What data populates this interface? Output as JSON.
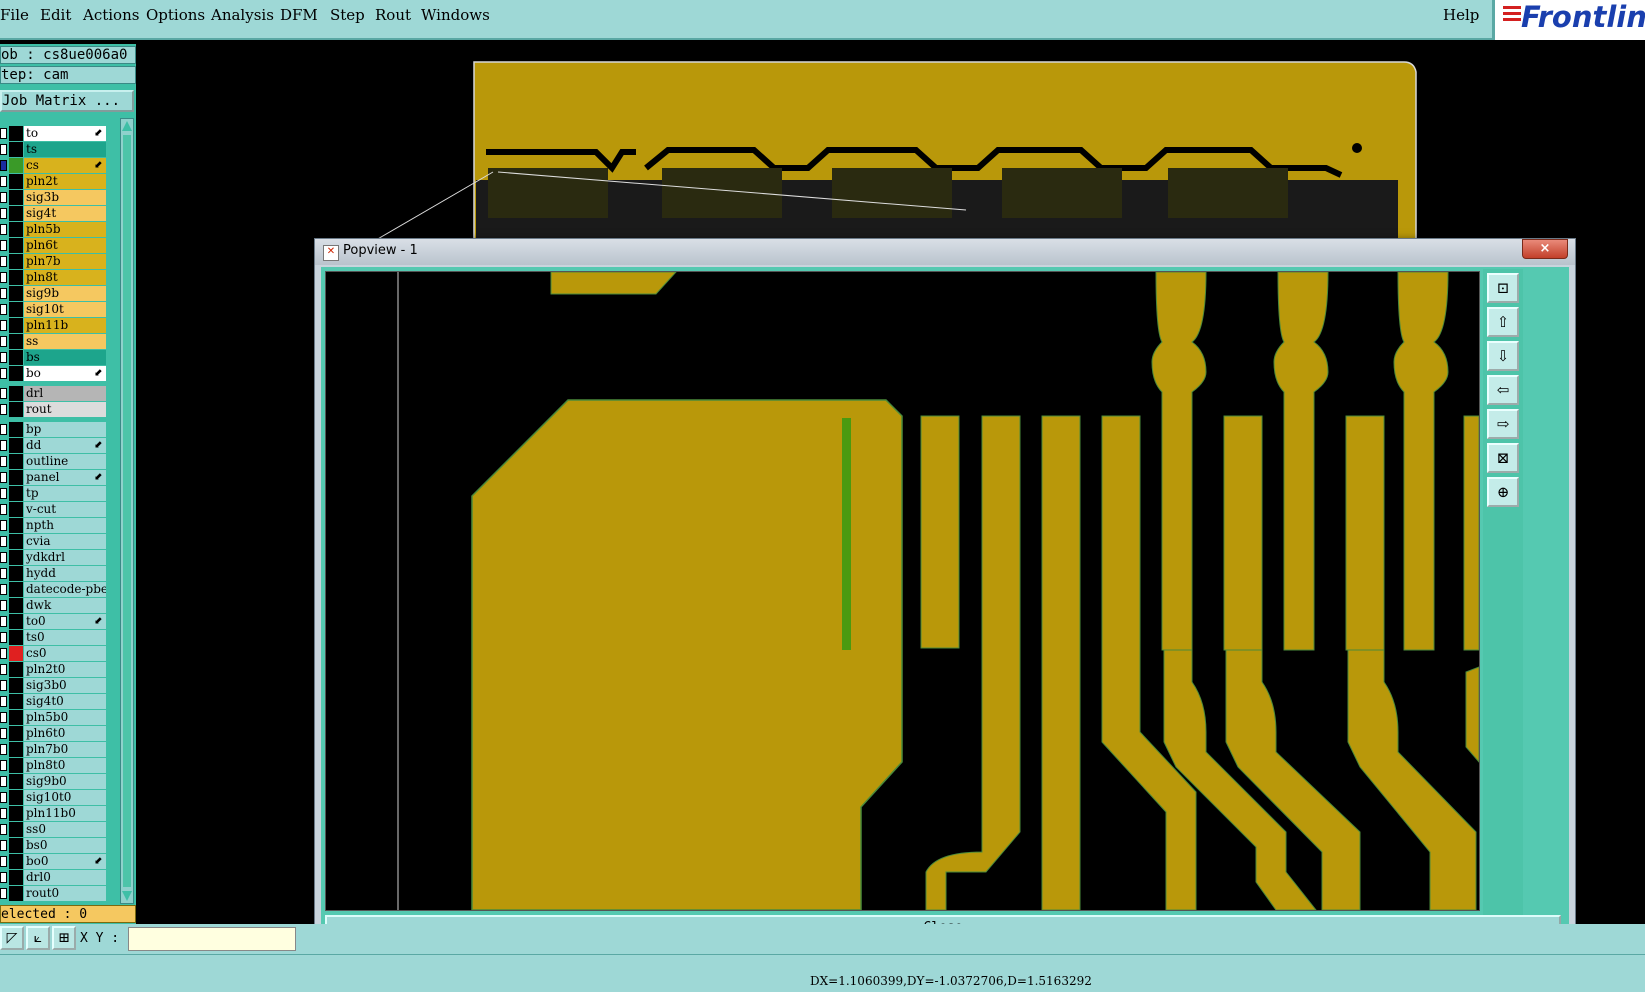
{
  "menubar": {
    "items": [
      "File",
      "Edit",
      "Actions",
      "Options",
      "Analysis",
      "DFM",
      "Step",
      "Rout",
      "Windows"
    ],
    "help": "Help",
    "logo": "Frontline"
  },
  "job": {
    "job_line": "ob  : cs8ue006a0",
    "step_line": "tep: cam",
    "matrix_button": "Job Matrix ..."
  },
  "layers": [
    {
      "name": "to",
      "bg": "#ffffff",
      "swatch": "#000000",
      "icon": true
    },
    {
      "name": "ts",
      "bg": "#1da58c",
      "swatch": "#000000"
    },
    {
      "name": "cs",
      "bg": "#d8b21d",
      "swatch": "#3a9a28",
      "icon": true,
      "checked_color": "#1a2aa0"
    },
    {
      "name": "pln2t",
      "bg": "#d8b21d",
      "swatch": "#000000"
    },
    {
      "name": "sig3b",
      "bg": "#f5c860",
      "swatch": "#000000"
    },
    {
      "name": "sig4t",
      "bg": "#f5c860",
      "swatch": "#000000"
    },
    {
      "name": "pln5b",
      "bg": "#d8b21d",
      "swatch": "#000000"
    },
    {
      "name": "pln6t",
      "bg": "#d8b21d",
      "swatch": "#000000"
    },
    {
      "name": "pln7b",
      "bg": "#d8b21d",
      "swatch": "#000000"
    },
    {
      "name": "pln8t",
      "bg": "#d8b21d",
      "swatch": "#000000"
    },
    {
      "name": "sig9b",
      "bg": "#f5c860",
      "swatch": "#000000"
    },
    {
      "name": "sig10t",
      "bg": "#f5c860",
      "swatch": "#000000"
    },
    {
      "name": "pln11b",
      "bg": "#d8b21d",
      "swatch": "#000000"
    },
    {
      "name": "ss",
      "bg": "#f5c860",
      "swatch": "#000000"
    },
    {
      "name": "bs",
      "bg": "#1da58c",
      "swatch": "#000000"
    },
    {
      "name": "bo",
      "bg": "#ffffff",
      "swatch": "#000000",
      "icon": true
    },
    {
      "name": "drl",
      "bg": "#b5b5b5",
      "swatch": "#000000",
      "gap": true
    },
    {
      "name": "rout",
      "bg": "#dcdcdc",
      "swatch": "#000000"
    },
    {
      "name": "bp",
      "bg": "#9ed8d6",
      "swatch": "#000000",
      "gap": true
    },
    {
      "name": "dd",
      "bg": "#9ed8d6",
      "swatch": "#000000",
      "icon": true
    },
    {
      "name": "outline",
      "bg": "#9ed8d6",
      "swatch": "#000000"
    },
    {
      "name": "panel",
      "bg": "#9ed8d6",
      "swatch": "#000000",
      "icon": true
    },
    {
      "name": "tp",
      "bg": "#9ed8d6",
      "swatch": "#000000"
    },
    {
      "name": "v-cut",
      "bg": "#9ed8d6",
      "swatch": "#000000"
    },
    {
      "name": "npth",
      "bg": "#9ed8d6",
      "swatch": "#000000"
    },
    {
      "name": "cvia",
      "bg": "#9ed8d6",
      "swatch": "#000000"
    },
    {
      "name": "ydkdrl",
      "bg": "#9ed8d6",
      "swatch": "#000000"
    },
    {
      "name": "hydd",
      "bg": "#9ed8d6",
      "swatch": "#000000"
    },
    {
      "name": "datecode-pbe",
      "bg": "#9ed8d6",
      "swatch": "#000000"
    },
    {
      "name": "dwk",
      "bg": "#9ed8d6",
      "swatch": "#000000"
    },
    {
      "name": "to0",
      "bg": "#9ed8d6",
      "swatch": "#000000",
      "icon": true
    },
    {
      "name": "ts0",
      "bg": "#9ed8d6",
      "swatch": "#000000"
    },
    {
      "name": "cs0",
      "bg": "#9ed8d6",
      "swatch": "#e02020"
    },
    {
      "name": "pln2t0",
      "bg": "#9ed8d6",
      "swatch": "#000000"
    },
    {
      "name": "sig3b0",
      "bg": "#9ed8d6",
      "swatch": "#000000"
    },
    {
      "name": "sig4t0",
      "bg": "#9ed8d6",
      "swatch": "#000000"
    },
    {
      "name": "pln5b0",
      "bg": "#9ed8d6",
      "swatch": "#000000"
    },
    {
      "name": "pln6t0",
      "bg": "#9ed8d6",
      "swatch": "#000000"
    },
    {
      "name": "pln7b0",
      "bg": "#9ed8d6",
      "swatch": "#000000"
    },
    {
      "name": "pln8t0",
      "bg": "#9ed8d6",
      "swatch": "#000000"
    },
    {
      "name": "sig9b0",
      "bg": "#9ed8d6",
      "swatch": "#000000"
    },
    {
      "name": "sig10t0",
      "bg": "#9ed8d6",
      "swatch": "#000000"
    },
    {
      "name": "pln11b0",
      "bg": "#9ed8d6",
      "swatch": "#000000"
    },
    {
      "name": "ss0",
      "bg": "#9ed8d6",
      "swatch": "#000000"
    },
    {
      "name": "bs0",
      "bg": "#9ed8d6",
      "swatch": "#000000"
    },
    {
      "name": "bo0",
      "bg": "#9ed8d6",
      "swatch": "#000000",
      "icon": true
    },
    {
      "name": "drl0",
      "bg": "#9ed8d6",
      "swatch": "#000000"
    },
    {
      "name": "rout0",
      "bg": "#9ed8d6",
      "swatch": "#000000"
    }
  ],
  "selected_text": "elected : 0",
  "xy_label": "X Y :",
  "xy_value": "",
  "status": "DX=1.1060399,DY=-1.0372706,D=1.5163292",
  "popup": {
    "title": "Popview - 1",
    "close_icon": "×",
    "close_label": "Close"
  },
  "colors": {
    "copper": "#b9980a",
    "board_bg": "#000000",
    "panel_teal": "#9ed8d6",
    "green_trace": "#4a9a10"
  }
}
